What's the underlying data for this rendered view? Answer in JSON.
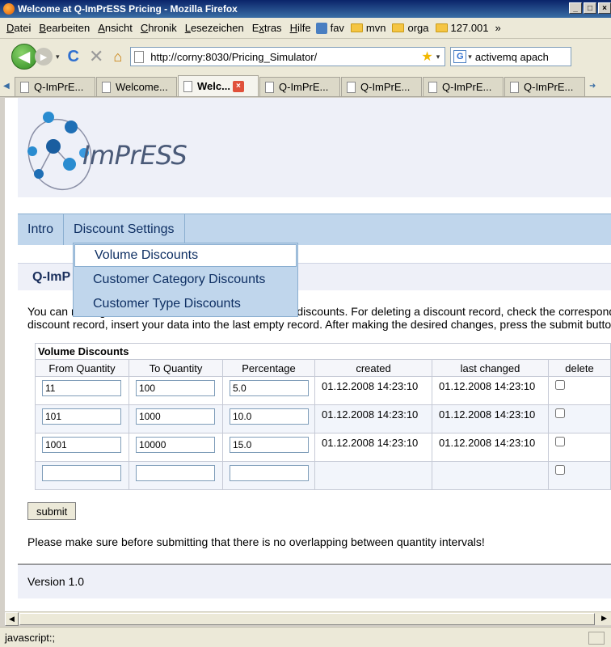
{
  "window": {
    "title": "Welcome at Q-ImPrESS Pricing - Mozilla Firefox",
    "controls": [
      "_",
      "□",
      "×"
    ]
  },
  "menubar": {
    "items": [
      {
        "u": "D",
        "rest": "atei"
      },
      {
        "u": "B",
        "rest": "earbeiten"
      },
      {
        "u": "A",
        "rest": "nsicht"
      },
      {
        "u": "C",
        "rest": "hronik"
      },
      {
        "u": "L",
        "rest": "esezeichen"
      },
      {
        "pre": "E",
        "u": "x",
        "rest": "tras"
      },
      {
        "u": "H",
        "rest": "ilfe"
      }
    ],
    "bookmarks": [
      "fav",
      "mvn",
      "orga",
      "127.001"
    ],
    "overflow": "»"
  },
  "navbar": {
    "back_icon": "◀",
    "forward_icon": "▶",
    "dropdown_icon": "▾",
    "reload_icon": "C",
    "stop_icon": "✕",
    "home_icon": "⌂",
    "url": "http://corny:8030/Pricing_Simulator/",
    "star_icon": "★",
    "url_dropdown": "▾",
    "search_engine": "G",
    "search_dropdown": "▾",
    "search_text": "activemq apach"
  },
  "tabs": {
    "scroll_left": "◀",
    "items": [
      "Q-ImPrE...",
      "Welcome...",
      "Welc...",
      "Q-ImPrE...",
      "Q-ImPrE...",
      "Q-ImPrE...",
      "Q-ImPrE..."
    ],
    "active_index": 2,
    "close_icon": "×",
    "scroll_right": "➜"
  },
  "page": {
    "logo_text": "ImPrESS",
    "nav": [
      "Intro",
      "Discount Settings"
    ],
    "dropdown": [
      "Volume Discounts",
      "Customer Category Discounts",
      "Customer Type Discounts"
    ],
    "section_title": "Q-ImP",
    "intro_line1": "You can manage the discount values of the individual discounts. For deleting a discount record, check the corresponding",
    "intro_line2": "discount record, insert your data into the last empty record. After making the desired changes, press the submit button.",
    "table": {
      "caption": "Volume Discounts",
      "headers": [
        "From Quantity",
        "To Quantity",
        "Percentage",
        "created",
        "last changed",
        "delete"
      ],
      "rows": [
        {
          "from": "11",
          "to": "100",
          "pct": "5.0",
          "created": "01.12.2008 14:23:10",
          "changed": "01.12.2008 14:23:10"
        },
        {
          "from": "101",
          "to": "1000",
          "pct": "10.0",
          "created": "01.12.2008 14:23:10",
          "changed": "01.12.2008 14:23:10"
        },
        {
          "from": "1001",
          "to": "10000",
          "pct": "15.0",
          "created": "01.12.2008 14:23:10",
          "changed": "01.12.2008 14:23:10"
        },
        {
          "from": "",
          "to": "",
          "pct": "",
          "created": "",
          "changed": ""
        }
      ]
    },
    "submit_label": "submit",
    "warning": "Please make sure before submitting that there is no overlapping between quantity intervals!",
    "version": "Version 1.0"
  },
  "scrollbar": {
    "left_arrow": "◀",
    "right_arrow": "▶"
  },
  "status": "javascript:;"
}
